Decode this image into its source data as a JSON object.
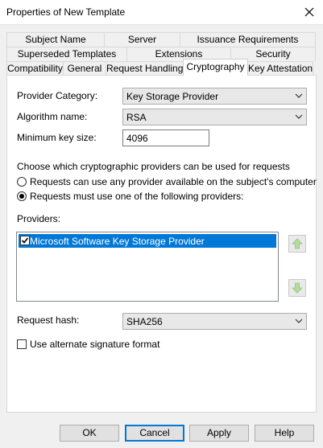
{
  "window": {
    "title": "Properties of New Template"
  },
  "tabs": {
    "row1": [
      "Subject Name",
      "Server",
      "Issuance Requirements"
    ],
    "row2": [
      "Superseded Templates",
      "Extensions",
      "Security"
    ],
    "row3": [
      "Compatibility",
      "General",
      "Request Handling",
      "Cryptography",
      "Key Attestation"
    ],
    "active": "Cryptography"
  },
  "form": {
    "provider_category_label": "Provider Category:",
    "provider_category_value": "Key Storage Provider",
    "algorithm_label": "Algorithm name:",
    "algorithm_value": "RSA",
    "min_key_label": "Minimum key size:",
    "min_key_value": "4096",
    "choose_text": "Choose which cryptographic providers can be used for requests",
    "radio_any": "Requests can use any provider available on the subject's computer",
    "radio_must": "Requests must use one of the following providers:",
    "providers_label": "Providers:",
    "providers": [
      {
        "name": "Microsoft Software Key Storage Provider",
        "checked": true
      }
    ],
    "hash_label": "Request hash:",
    "hash_value": "SHA256",
    "alt_sig_label": "Use alternate signature format",
    "selected_radio": "must",
    "alt_sig_checked": false
  },
  "buttons": {
    "ok": "OK",
    "cancel": "Cancel",
    "apply": "Apply",
    "help": "Help"
  },
  "colors": {
    "selection": "#0078d7",
    "arrow_green": "#6cbf3a"
  }
}
